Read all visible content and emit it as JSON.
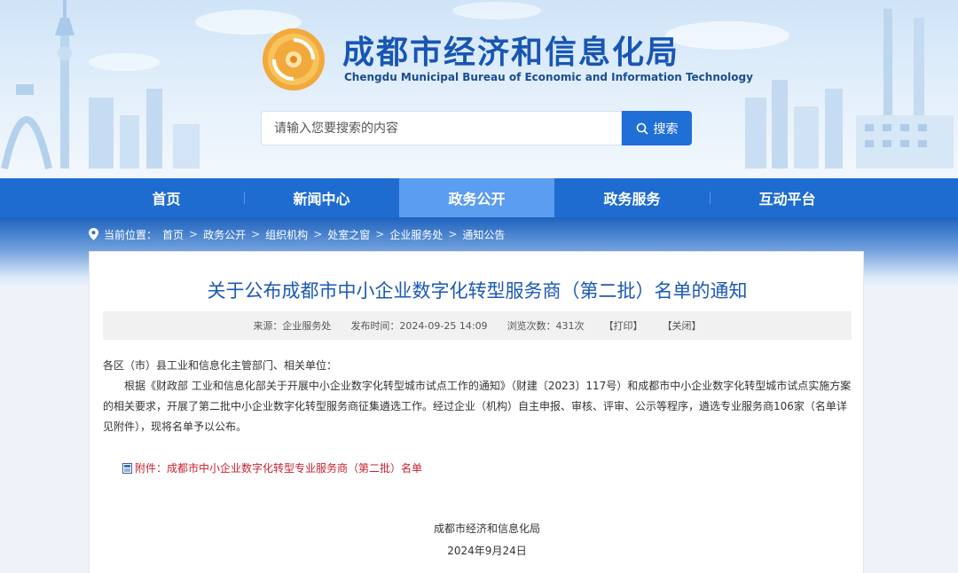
{
  "header": {
    "title": "成都市经济和信息化局",
    "subtitle": "Chengdu Municipal Bureau of Economic and Information Technology",
    "search_placeholder": "请输入您要搜索的内容",
    "search_button": "搜索"
  },
  "nav": {
    "items": [
      {
        "label": "首页"
      },
      {
        "label": "新闻中心"
      },
      {
        "label": "政务公开"
      },
      {
        "label": "政务服务"
      },
      {
        "label": "互动平台"
      }
    ],
    "active_index": 2
  },
  "breadcrumb": {
    "prefix": "当前位置：",
    "items": [
      "首页",
      "政务公开",
      "组织机构",
      "处室之窗",
      "企业服务处",
      "通知公告"
    ],
    "separator": ">"
  },
  "article": {
    "title": "关于公布成都市中小企业数字化转型服务商（第二批）名单的通知",
    "meta": {
      "source": "来源：企业服务处",
      "published": "发布时间：2024-09-25 14:09",
      "views": "浏览次数：431次",
      "print": "【打印】",
      "close": "【关闭】"
    },
    "salutation": "各区（市）县工业和信息化主管部门、相关单位：",
    "paragraph": "根据《财政部 工业和信息化部关于开展中小企业数字化转型城市试点工作的通知》（财建〔2023〕117号）和成都市中小企业数字化转型城市试点实施方案的相关要求，开展了第二批中小企业数字化转型服务商征集遴选工作。经过企业（机构）自主申报、审核、评审、公示等程序，遴选专业服务商106家（名单详见附件），现将名单予以公布。",
    "attachment": "附件：成都市中小企业数字化转型专业服务商（第二批）名单",
    "signature": "成都市经济和信息化局",
    "date": "2024年9月24日"
  },
  "colors": {
    "brand_blue": "#1f6cd1",
    "title_blue": "#1c58b5",
    "active_tab": "#5b9df0",
    "attachment_red": "#c8202d"
  },
  "icons": {
    "logo": "bureau-emblem-icon",
    "search": "search-icon",
    "location": "location-pin-icon",
    "attachment": "document-icon"
  }
}
